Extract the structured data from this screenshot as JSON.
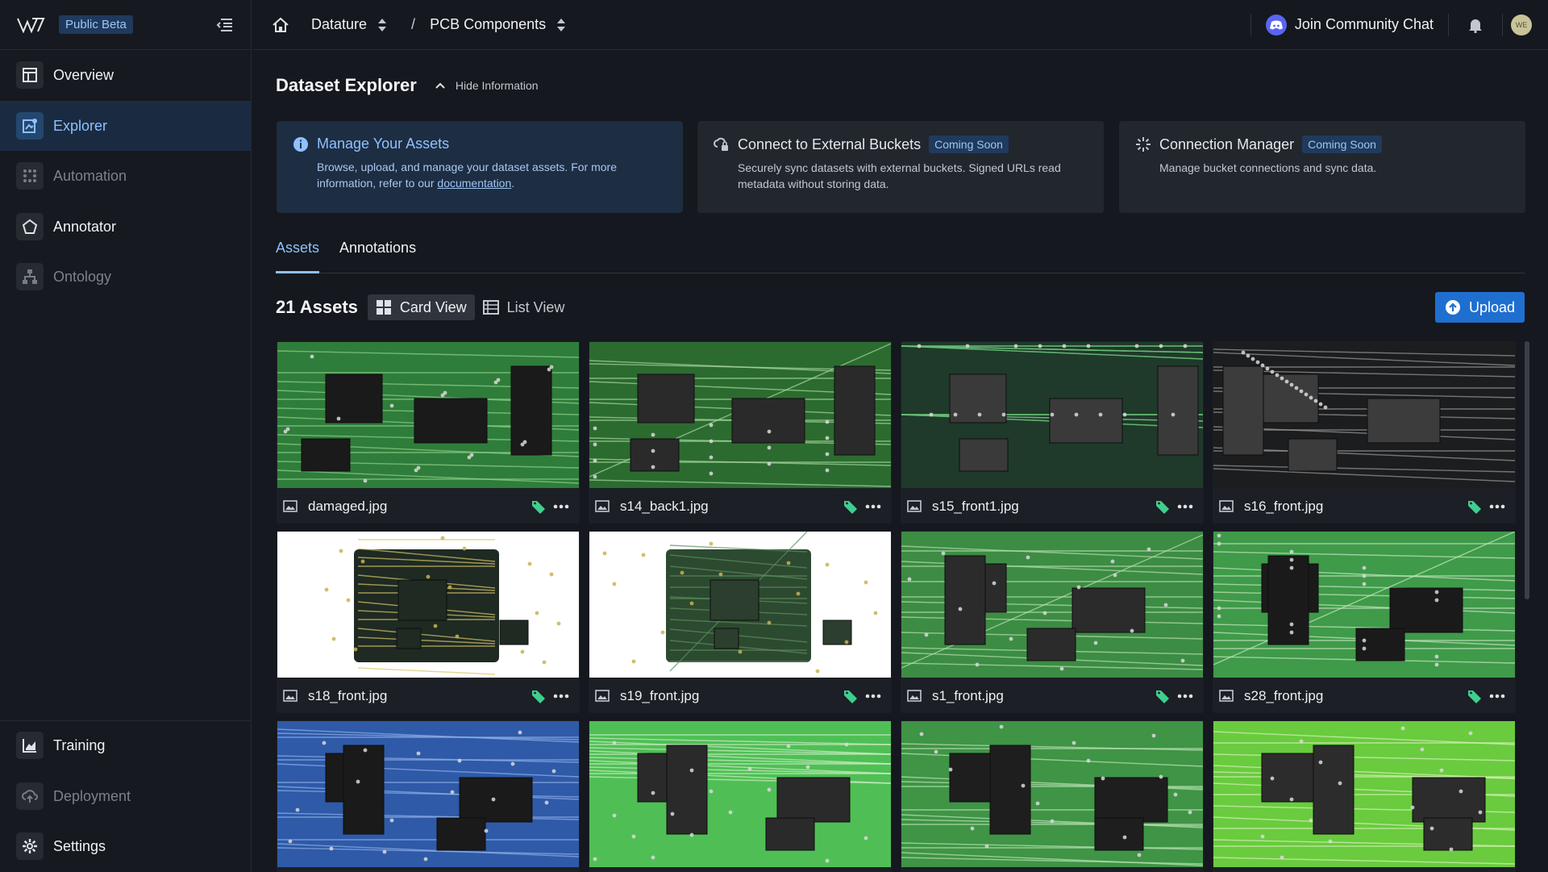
{
  "sidebar": {
    "badge": "Public Beta",
    "items": [
      {
        "label": "Overview",
        "icon": "overview-icon"
      },
      {
        "label": "Explorer",
        "icon": "explorer-icon"
      },
      {
        "label": "Automation",
        "icon": "automation-icon"
      },
      {
        "label": "Annotator",
        "icon": "annotator-icon"
      },
      {
        "label": "Ontology",
        "icon": "ontology-icon"
      },
      {
        "label": "Training",
        "icon": "training-icon"
      },
      {
        "label": "Deployment",
        "icon": "deployment-icon"
      },
      {
        "label": "Settings",
        "icon": "settings-icon"
      }
    ]
  },
  "topbar": {
    "breadcrumb": [
      "Datature",
      "PCB Components"
    ],
    "separator": "/",
    "community": "Join Community Chat",
    "avatar_initials": "WE"
  },
  "page": {
    "title": "Dataset Explorer",
    "hide_info": "Hide Information"
  },
  "info_cards": [
    {
      "title": "Manage Your Assets",
      "body": "Browse, upload, and manage your dataset assets. For more information, refer to our",
      "link": "documentation",
      "link_suffix": "."
    },
    {
      "title": "Connect to External Buckets",
      "badge": "Coming Soon",
      "body": "Securely sync datasets with external buckets. Signed URLs read metadata without storing data."
    },
    {
      "title": "Connection Manager",
      "badge": "Coming Soon",
      "body": "Manage bucket connections and sync data."
    }
  ],
  "tabs": [
    "Assets",
    "Annotations"
  ],
  "assets": {
    "count_label": "21 Assets",
    "card_view": "Card View",
    "list_view": "List View",
    "upload": "Upload",
    "items": [
      "damaged.jpg",
      "s14_back1.jpg",
      "s15_front1.jpg",
      "s16_front.jpg",
      "s18_front.jpg",
      "s19_front.jpg",
      "s1_front.jpg",
      "s28_front.jpg",
      "",
      "",
      "",
      ""
    ]
  },
  "colors": {
    "accent": "#8fc0ff",
    "brand_blue": "#1f6fd0",
    "tag_green": "#3ecf8e",
    "discord": "#5865f2"
  }
}
